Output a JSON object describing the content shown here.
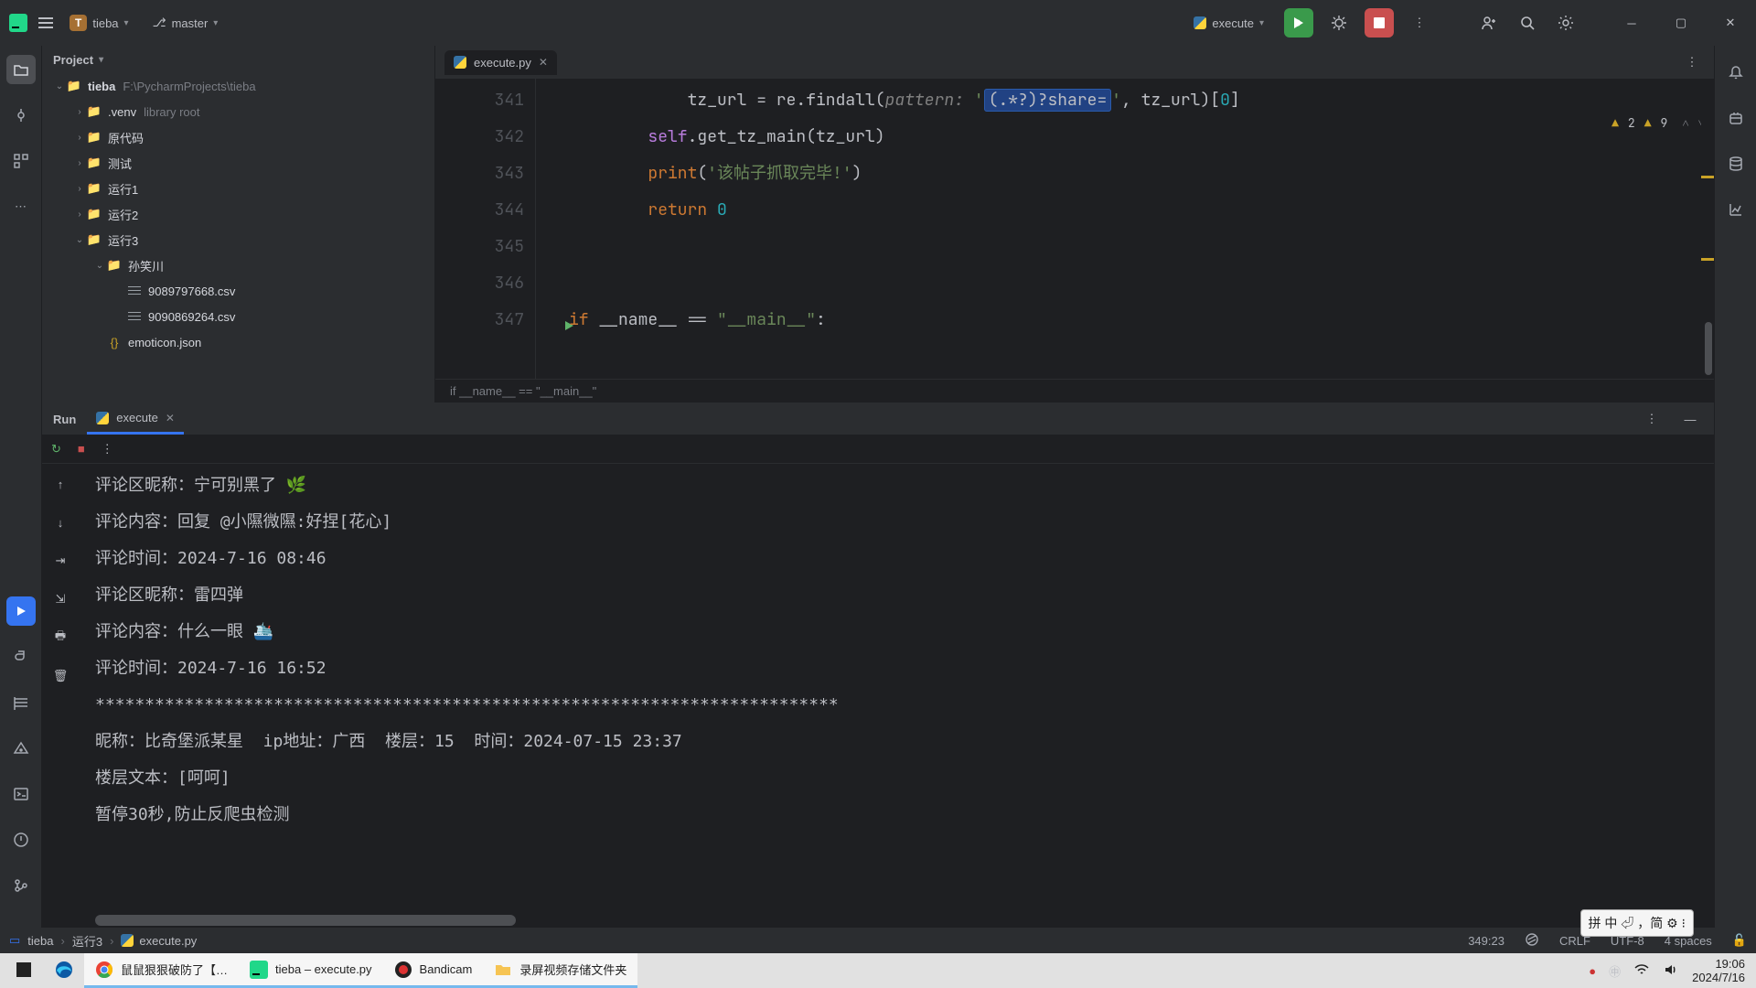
{
  "titlebar": {
    "project_initial": "T",
    "project_name": "tieba",
    "branch": "master",
    "run_config": "execute"
  },
  "project_panel": {
    "title": "Project",
    "root_name": "tieba",
    "root_path": "F:\\PycharmProjects\\tieba",
    "items": [
      {
        "indent": 1,
        "caret": "›",
        "icon": "folder",
        "label": ".venv",
        "sub": "library root"
      },
      {
        "indent": 1,
        "caret": "›",
        "icon": "folder",
        "label": "原代码"
      },
      {
        "indent": 1,
        "caret": "›",
        "icon": "folder",
        "label": "测试"
      },
      {
        "indent": 1,
        "caret": "›",
        "icon": "folder",
        "label": "运行1"
      },
      {
        "indent": 1,
        "caret": "›",
        "icon": "folder",
        "label": "运行2"
      },
      {
        "indent": 1,
        "caret": "⌄",
        "icon": "folder",
        "label": "运行3"
      },
      {
        "indent": 2,
        "caret": "⌄",
        "icon": "folder",
        "label": "孙笑川"
      },
      {
        "indent": 3,
        "caret": "",
        "icon": "csv",
        "label": "9089797668.csv"
      },
      {
        "indent": 3,
        "caret": "",
        "icon": "csv",
        "label": "9090869264.csv"
      },
      {
        "indent": 2,
        "caret": "",
        "icon": "json",
        "label": "emoticon.json"
      }
    ]
  },
  "editor": {
    "tab_name": "execute.py",
    "problems": {
      "warn": "2",
      "weak": "9"
    },
    "gutter_start": 341,
    "breadcrumb": "if __name__ == \"__main__\"",
    "lines": [
      {
        "n": 341,
        "html": "            tz_url = re.findall(<span class='param'>pattern:</span> <span class='str'>'</span><span class='hl-box'>(.*?)?share=</span><span class='str'>'</span>, tz_url)[<span class='num'>0</span>]"
      },
      {
        "n": 342,
        "html": "        <span class='self'>self</span>.get_tz_main(tz_url)"
      },
      {
        "n": 343,
        "html": "        <span class='kw'>print</span>(<span class='str'>'该帖子抓取完毕!'</span>)"
      },
      {
        "n": 344,
        "html": "        <span class='kw'>return</span> <span class='num'>0</span>"
      },
      {
        "n": 345,
        "html": ""
      },
      {
        "n": 346,
        "html": ""
      },
      {
        "n": 347,
        "html": "<span class='kw'>if</span> __name__ == <span class='str'>\"__main__\"</span>:",
        "run": true
      }
    ]
  },
  "run": {
    "title": "Run",
    "tab": "execute",
    "output": [
      "评论区昵称：宁可别黑了 🌿",
      "评论内容：回复 @小隰微隰:好捏[花心]",
      "评论时间：2024-7-16 08:46",
      "评论区昵称：雷四弹",
      "评论内容：什么一眼 🛳️",
      "评论时间：2024-7-16 16:52",
      "***************************************************************************",
      "昵称：比奇堡派某星  ip地址：广西  楼层：15  时间：2024-07-15 23:37",
      "楼层文本：[呵呵]",
      "暂停30秒,防止反爬虫检测"
    ]
  },
  "statusbar": {
    "crumbs": [
      "tieba",
      "运行3",
      "execute.py"
    ],
    "caret": "349:23",
    "eol": "CRLF",
    "encoding": "UTF-8",
    "indent": "4 spaces"
  },
  "ime": "拼 中 ⏎ ，简 ⚙ ⁝",
  "taskbar": {
    "items": [
      {
        "icon": "win",
        "label": ""
      },
      {
        "icon": "edge",
        "label": ""
      },
      {
        "icon": "chrome",
        "label": "鼠鼠狠狠破防了【…",
        "active": true
      },
      {
        "icon": "pycharm",
        "label": "tieba – execute.py",
        "active": true
      },
      {
        "icon": "band",
        "label": "Bandicam",
        "active": true
      },
      {
        "icon": "folder",
        "label": "录屏视频存储文件夹",
        "active": true
      }
    ],
    "clock_time": "19:06",
    "clock_date": "2024/7/16"
  }
}
